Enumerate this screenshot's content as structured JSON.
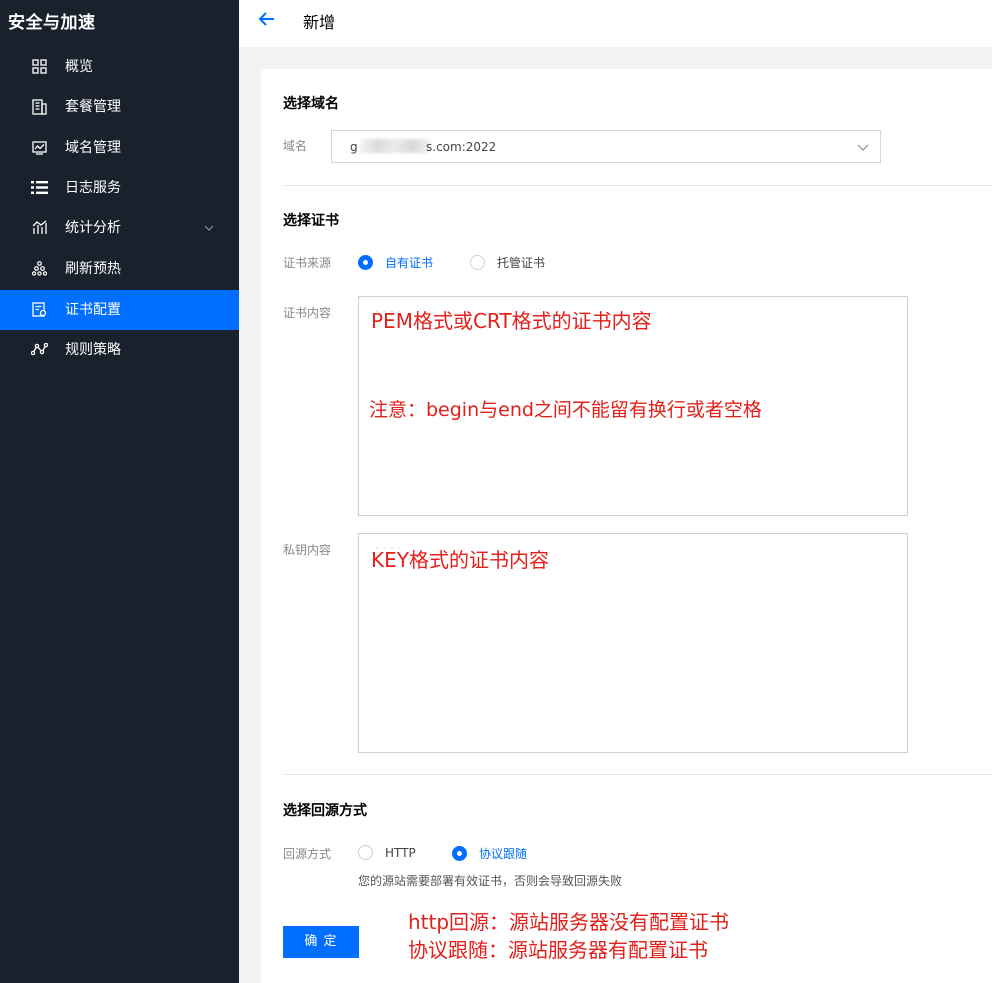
{
  "app_title": "安全与加速",
  "sidebar": {
    "items": [
      {
        "label": "概览",
        "icon": "grid-icon"
      },
      {
        "label": "套餐管理",
        "icon": "building-icon"
      },
      {
        "label": "域名管理",
        "icon": "monitor-icon"
      },
      {
        "label": "日志服务",
        "icon": "list-icon"
      },
      {
        "label": "统计分析",
        "icon": "bar-chart-icon"
      },
      {
        "label": "刷新预热",
        "icon": "hierarchy-icon"
      },
      {
        "label": "证书配置",
        "icon": "certificate-icon"
      },
      {
        "label": "规则策略",
        "icon": "route-icon"
      }
    ],
    "active_index": 6
  },
  "header": {
    "title": "新增"
  },
  "domain_section": {
    "title": "选择域名",
    "field_label": "域名",
    "selected_value_prefix": "g",
    "selected_value_suffix": "s.com:2022"
  },
  "cert_section": {
    "title": "选择证书",
    "source_label": "证书来源",
    "source_options": [
      "自有证书",
      "托管证书"
    ],
    "source_selected": "自有证书",
    "content_label": "证书内容",
    "key_label": "私钥内容"
  },
  "origin_section": {
    "title": "选择回源方式",
    "field_label": "回源方式",
    "options": [
      "HTTP",
      "协议跟随"
    ],
    "selected": "协议跟随",
    "hint": "您的源站需要部署有效证书，否则会导致回源失败"
  },
  "confirm_label": "确 定",
  "annotations": {
    "cert_line1": "PEM格式或CRT格式的证书内容",
    "cert_line2": "注意：begin与end之间不能留有换行或者空格",
    "key_line1": "KEY格式的证书内容",
    "origin_line1": "http回源：源站服务器没有配置证书",
    "origin_line2": "协议跟随：源站服务器有配置证书"
  },
  "colors": {
    "sidebar_bg": "#18212c",
    "accent": "#006eff",
    "annotation": "#e3201b"
  }
}
